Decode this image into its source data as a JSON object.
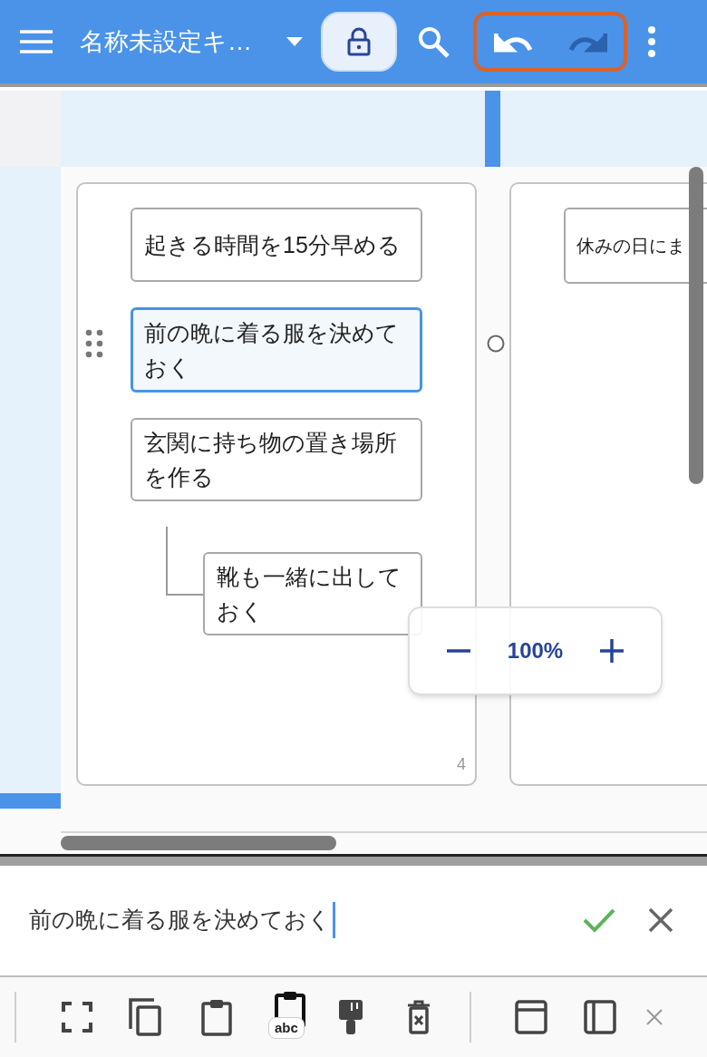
{
  "header": {
    "title": "名称未設定キ…"
  },
  "canvas": {
    "cards": [
      {
        "count": "4",
        "nodes": [
          {
            "text": "起きる時間を15分早める",
            "selected": false
          },
          {
            "text": "前の晩に着る服を決めておく",
            "selected": true
          },
          {
            "text": "玄関に持ち物の置き場所を作る",
            "selected": false,
            "children": [
              {
                "text": "靴も一緒に出しておく",
                "selected": false
              }
            ]
          }
        ]
      },
      {
        "nodes": [
          {
            "text": "休みの日にま",
            "selected": false
          }
        ]
      }
    ]
  },
  "zoom": {
    "value": "100%"
  },
  "editor": {
    "value": "前の晩に着る服を決めておく"
  },
  "toolbar": {
    "badge": "abc"
  }
}
